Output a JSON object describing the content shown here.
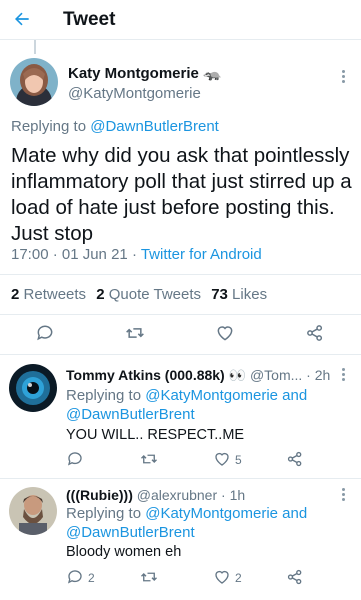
{
  "header": {
    "title": "Tweet"
  },
  "tweet": {
    "name": "Katy Montgomerie",
    "name_emoji": "🦡",
    "handle": "@KatyMontgomerie",
    "replying_prefix": "Replying to",
    "replying_to": "@DawnButlerBrent",
    "text": "Mate why did you ask that pointlessly inflammatory poll that just stirred up a load of hate just before posting this. Just stop",
    "time": "17:00 · 01 Jun 21",
    "separator": "·",
    "source": "Twitter for Android",
    "retweets_count": "2",
    "retweets_label": "Retweets",
    "quote_count": "2",
    "quote_label": "Quote Tweets",
    "likes_count": "73",
    "likes_label": "Likes"
  },
  "replies": [
    {
      "name": "Tommy Atkins (000.88k)",
      "emoji": "👀",
      "handle_time": "@Tom... · 2h",
      "replying_prefix": "Replying to",
      "mentions_line1": "@KatyMontgomerie and",
      "mentions_line2": "@DawnButlerBrent",
      "text": "YOU WILL.. RESPECT..ME",
      "replies_count": "",
      "retweets_count": "",
      "likes_count": "5"
    },
    {
      "name": "(((Rubie)))",
      "emoji": "",
      "handle_time": "@alexrubner · 1h",
      "replying_prefix": "Replying to",
      "mentions_line1": "@KatyMontgomerie and",
      "mentions_line2": "@DawnButlerBrent",
      "text": "Bloody women eh",
      "replies_count": "2",
      "retweets_count": "",
      "likes_count": "2"
    }
  ],
  "colors": {
    "accent": "#1b95e0",
    "secondary": "#657786",
    "text": "#0f1419",
    "divider": "#e6ecf0"
  }
}
